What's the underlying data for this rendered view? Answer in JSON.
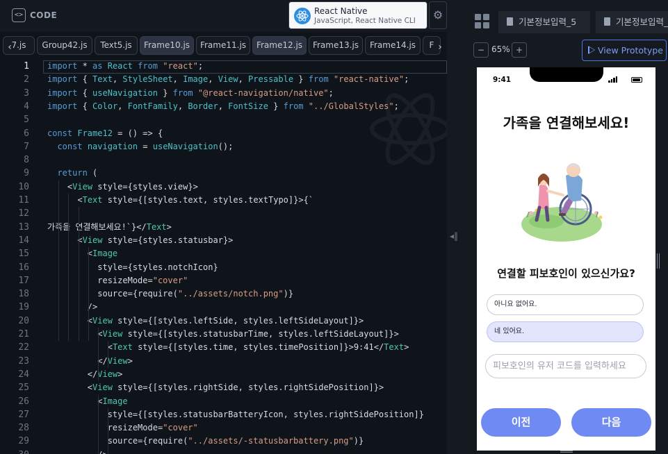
{
  "code_header": {
    "logo_glyph": "<>",
    "title": "CODE",
    "framework": {
      "name": "React Native",
      "subtitle": "JavaScript, React Native CLI"
    },
    "settings_glyph": "⚙"
  },
  "file_tabs": [
    "7.js",
    "Group42.js",
    "Text5.js",
    "Frame10.js",
    "Frame11.js",
    "Frame12.js",
    "Frame13.js",
    "Frame14.js",
    "F"
  ],
  "code": {
    "lines": [
      {
        "no": "1",
        "text": "import * as React from \"react\";"
      },
      {
        "no": "2",
        "text": "import { Text, StyleSheet, Image, View, Pressable } from \"react-native\";"
      },
      {
        "no": "3",
        "text": "import { useNavigation } from \"@react-navigation/native\";"
      },
      {
        "no": "4",
        "text": "import { Color, FontFamily, Border, FontSize } from \"../GlobalStyles\";"
      },
      {
        "no": "5",
        "text": ""
      },
      {
        "no": "6",
        "text": "const Frame12 = () => {"
      },
      {
        "no": "7",
        "text": "  const navigation = useNavigation();"
      },
      {
        "no": "8",
        "text": ""
      },
      {
        "no": "9",
        "text": "  return ("
      },
      {
        "no": "10",
        "text": "    <View style={styles.view}>"
      },
      {
        "no": "11",
        "text": "      <Text style={[styles.text, styles.textTypo]}>{`"
      },
      {
        "no": "12",
        "text": ""
      },
      {
        "no": "13",
        "text": "가족을 연결해보세요!`}</Text>"
      },
      {
        "no": "14",
        "text": "      <View style={styles.statusbar}>"
      },
      {
        "no": "15",
        "text": "        <Image"
      },
      {
        "no": "16",
        "text": "          style={styles.notchIcon}"
      },
      {
        "no": "17",
        "text": "          resizeMode=\"cover\""
      },
      {
        "no": "18",
        "text": "          source={require(\"../assets/notch.png\")}"
      },
      {
        "no": "19",
        "text": "        />"
      },
      {
        "no": "20",
        "text": "        <View style={[styles.leftSide, styles.leftSideLayout]}>"
      },
      {
        "no": "21",
        "text": "          <View style={[styles.statusbarTime, styles.leftSideLayout]}>"
      },
      {
        "no": "22",
        "text": "            <Text style={[styles.time, styles.timePosition]}>9:41</Text>"
      },
      {
        "no": "23",
        "text": "          </View>"
      },
      {
        "no": "24",
        "text": "        </View>"
      },
      {
        "no": "25",
        "text": "        <View style={[styles.rightSide, styles.rightSidePosition]}>"
      },
      {
        "no": "26",
        "text": "          <Image"
      },
      {
        "no": "27",
        "text": "            style={[styles.statusbarBatteryIcon, styles.rightSidePosition]}"
      },
      {
        "no": "28",
        "text": "            resizeMode=\"cover\""
      },
      {
        "no": "29",
        "text": "            source={require(\"../assets/-statusbarbattery.png\")}"
      },
      {
        "no": "30",
        "text": "          />"
      }
    ],
    "syntax_colors": {
      "keyword": "#569cd6",
      "identifier": "#4fc1c9",
      "string": "#d69d85",
      "tag": "#4ec9b0",
      "plain": "#d7dbe2"
    }
  },
  "preview": {
    "page_tabs": [
      "기본정보입력_5",
      "기본정보입력_3"
    ],
    "zoom": {
      "level": "65%",
      "out_glyph": "−",
      "in_glyph": "+"
    },
    "view_prototype_label": "View Prototype"
  },
  "screen": {
    "status_time": "9:41",
    "title": "가족을 연결해보세요!",
    "question": "연결할 피보호인이 있으신가요?",
    "options": [
      "아니요 없어요.",
      "네 있어요."
    ],
    "code_placeholder": "피보호인의 유저 코드를 입력하세요",
    "prev_label": "이전",
    "next_label": "다음",
    "accent_color": "#6f8af2",
    "selected_option_color": "#e2e5fb"
  }
}
